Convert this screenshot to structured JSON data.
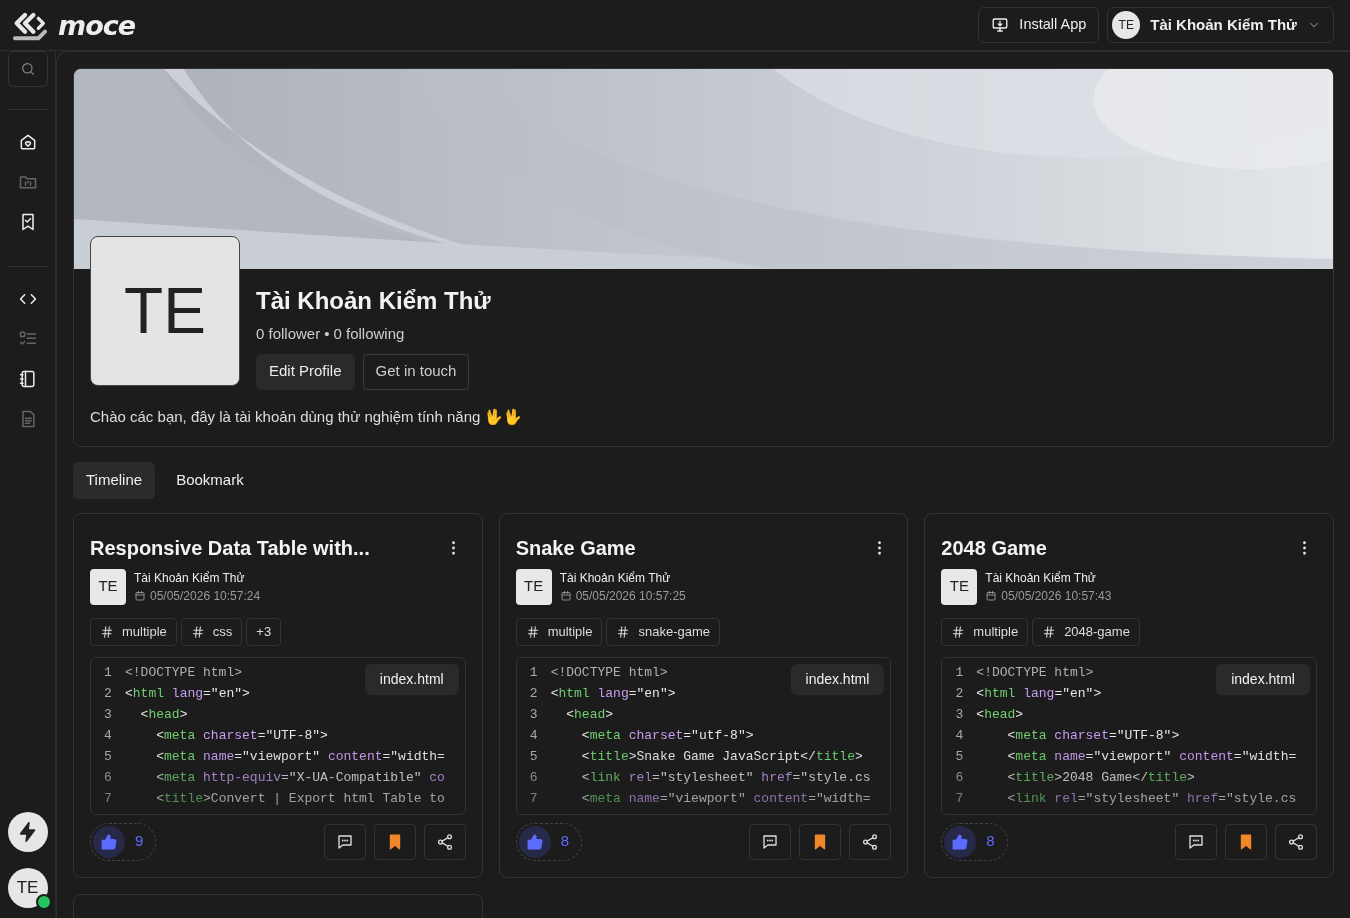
{
  "header": {
    "brand": "moce",
    "install_button": "Install App",
    "user": {
      "initials": "TE",
      "name": "Tài Khoản Kiểm Thử"
    }
  },
  "sidebar": {
    "groups": [
      [
        {
          "disabled": false
        },
        {
          "disabled": true
        },
        {
          "disabled": false
        }
      ],
      [
        {
          "disabled": false
        },
        {
          "disabled": true
        },
        {
          "disabled": false
        },
        {
          "disabled": true
        }
      ]
    ],
    "user": {
      "initials": "TE",
      "online": true
    }
  },
  "profile": {
    "initials": "TE",
    "name": "Tài Khoản Kiểm Thử",
    "followers": "0 follower",
    "following": "0 following",
    "separator": "•",
    "buttons": [
      {
        "label": "Edit Profile",
        "primary": true
      },
      {
        "label": "Get in touch",
        "primary": false
      }
    ],
    "bio": "Chào các bạn, đây là tài khoản dùng thử nghiệm tính năng 🖖🖖"
  },
  "tabs": [
    {
      "label": "Timeline",
      "selected": true
    },
    {
      "label": "Bookmark",
      "selected": false
    }
  ],
  "posts": [
    {
      "title": "Responsive Data Table with...",
      "author": "Tài Khoản Kiểm Thử",
      "initials": "TE",
      "date": "05/05/2026 10:57:24",
      "tags": [
        "multiple",
        "css"
      ],
      "more_tags": "+3",
      "file": "index.html",
      "likes": "9",
      "liked": true,
      "bookmarked": true,
      "code": [
        {
          "number": "1",
          "segments": [
            {
              "kind": "doc",
              "text": "<!DOCTYPE html>"
            }
          ]
        },
        {
          "number": "2",
          "segments": [
            {
              "kind": "p",
              "text": "<"
            },
            {
              "kind": "tag",
              "text": "html"
            },
            {
              "kind": "attr",
              "text": " lang"
            },
            {
              "kind": "p",
              "text": "=\"en\">"
            }
          ]
        },
        {
          "number": "3",
          "segments": [
            {
              "kind": "p",
              "text": "  <"
            },
            {
              "kind": "tag",
              "text": "head"
            },
            {
              "kind": "p",
              "text": ">"
            }
          ]
        },
        {
          "number": "4",
          "segments": [
            {
              "kind": "p",
              "text": "    <"
            },
            {
              "kind": "tag",
              "text": "meta"
            },
            {
              "kind": "attr",
              "text": " charset"
            },
            {
              "kind": "p",
              "text": "=\"UTF-8\">"
            }
          ]
        },
        {
          "number": "5",
          "segments": [
            {
              "kind": "p",
              "text": "    <"
            },
            {
              "kind": "tag",
              "text": "meta"
            },
            {
              "kind": "attr",
              "text": " name"
            },
            {
              "kind": "p",
              "text": "=\"viewport\""
            },
            {
              "kind": "attr",
              "text": " content"
            },
            {
              "kind": "p",
              "text": "=\"width="
            }
          ]
        },
        {
          "number": "6",
          "segments": [
            {
              "kind": "p",
              "text": "    <"
            },
            {
              "kind": "tag",
              "text": "meta"
            },
            {
              "kind": "attr",
              "text": " http-equiv"
            },
            {
              "kind": "p",
              "text": "=\"X-UA-Compatible\""
            },
            {
              "kind": "attr",
              "text": " co"
            }
          ]
        },
        {
          "number": "7",
          "segments": [
            {
              "kind": "p",
              "text": "    <"
            },
            {
              "kind": "tag",
              "text": "title"
            },
            {
              "kind": "p",
              "text": ">Convert | Export html Table to"
            }
          ]
        }
      ]
    },
    {
      "title": "Snake Game",
      "author": "Tài Khoản Kiểm Thử",
      "initials": "TE",
      "date": "05/05/2026 10:57:25",
      "tags": [
        "multiple",
        "snake-game"
      ],
      "file": "index.html",
      "likes": "8",
      "liked": true,
      "bookmarked": true,
      "code": [
        {
          "number": "1",
          "segments": [
            {
              "kind": "doc",
              "text": "<!DOCTYPE html>"
            }
          ]
        },
        {
          "number": "2",
          "segments": [
            {
              "kind": "p",
              "text": "<"
            },
            {
              "kind": "tag",
              "text": "html"
            },
            {
              "kind": "attr",
              "text": " lang"
            },
            {
              "kind": "p",
              "text": "=\"en\">"
            }
          ]
        },
        {
          "number": "3",
          "segments": [
            {
              "kind": "p",
              "text": "  <"
            },
            {
              "kind": "tag",
              "text": "head"
            },
            {
              "kind": "p",
              "text": ">"
            }
          ]
        },
        {
          "number": "4",
          "segments": [
            {
              "kind": "p",
              "text": "    <"
            },
            {
              "kind": "tag",
              "text": "meta"
            },
            {
              "kind": "attr",
              "text": " charset"
            },
            {
              "kind": "p",
              "text": "=\"utf-8\">"
            }
          ]
        },
        {
          "number": "5",
          "segments": [
            {
              "kind": "p",
              "text": "    <"
            },
            {
              "kind": "tag",
              "text": "title"
            },
            {
              "kind": "p",
              "text": ">Snake Game JavaScript</"
            },
            {
              "kind": "tag",
              "text": "title"
            },
            {
              "kind": "p",
              "text": ">"
            }
          ]
        },
        {
          "number": "6",
          "segments": [
            {
              "kind": "p",
              "text": "    <"
            },
            {
              "kind": "tag",
              "text": "link"
            },
            {
              "kind": "attr",
              "text": " rel"
            },
            {
              "kind": "p",
              "text": "=\"stylesheet\""
            },
            {
              "kind": "attr",
              "text": " href"
            },
            {
              "kind": "p",
              "text": "=\"style.cs"
            }
          ]
        },
        {
          "number": "7",
          "segments": [
            {
              "kind": "p",
              "text": "    <"
            },
            {
              "kind": "tag",
              "text": "meta"
            },
            {
              "kind": "attr",
              "text": " name"
            },
            {
              "kind": "p",
              "text": "=\"viewport\""
            },
            {
              "kind": "attr",
              "text": " content"
            },
            {
              "kind": "p",
              "text": "=\"width="
            }
          ]
        }
      ]
    },
    {
      "title": "2048 Game",
      "author": "Tài Khoản Kiểm Thử",
      "initials": "TE",
      "date": "05/05/2026 10:57:43",
      "tags": [
        "multiple",
        "2048-game"
      ],
      "file": "index.html",
      "likes": "8",
      "liked": true,
      "bookmarked": true,
      "code": [
        {
          "number": "1",
          "segments": [
            {
              "kind": "doc",
              "text": "<!DOCTYPE html>"
            }
          ]
        },
        {
          "number": "2",
          "segments": [
            {
              "kind": "p",
              "text": "<"
            },
            {
              "kind": "tag",
              "text": "html"
            },
            {
              "kind": "attr",
              "text": " lang"
            },
            {
              "kind": "p",
              "text": "=\"en\">"
            }
          ]
        },
        {
          "number": "3",
          "segments": [
            {
              "kind": "p",
              "text": "<"
            },
            {
              "kind": "tag",
              "text": "head"
            },
            {
              "kind": "p",
              "text": ">"
            }
          ]
        },
        {
          "number": "4",
          "segments": [
            {
              "kind": "p",
              "text": "    <"
            },
            {
              "kind": "tag",
              "text": "meta"
            },
            {
              "kind": "attr",
              "text": " charset"
            },
            {
              "kind": "p",
              "text": "=\"UTF-8\">"
            }
          ]
        },
        {
          "number": "5",
          "segments": [
            {
              "kind": "p",
              "text": "    <"
            },
            {
              "kind": "tag",
              "text": "meta"
            },
            {
              "kind": "attr",
              "text": " name"
            },
            {
              "kind": "p",
              "text": "=\"viewport\""
            },
            {
              "kind": "attr",
              "text": " content"
            },
            {
              "kind": "p",
              "text": "=\"width="
            }
          ]
        },
        {
          "number": "6",
          "segments": [
            {
              "kind": "p",
              "text": "    <"
            },
            {
              "kind": "tag",
              "text": "title"
            },
            {
              "kind": "p",
              "text": ">2048 Game</"
            },
            {
              "kind": "tag",
              "text": "title"
            },
            {
              "kind": "p",
              "text": ">"
            }
          ]
        },
        {
          "number": "7",
          "segments": [
            {
              "kind": "p",
              "text": "    <"
            },
            {
              "kind": "tag",
              "text": "link"
            },
            {
              "kind": "attr",
              "text": " rel"
            },
            {
              "kind": "p",
              "text": "=\"stylesheet\""
            },
            {
              "kind": "attr",
              "text": " href"
            },
            {
              "kind": "p",
              "text": "=\"style.cs"
            }
          ]
        }
      ]
    }
  ]
}
